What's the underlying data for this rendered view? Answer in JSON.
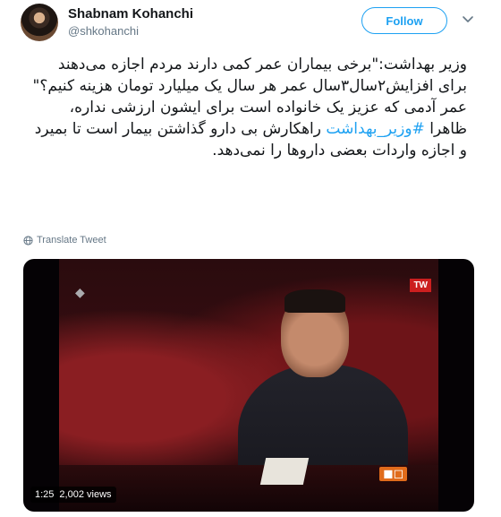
{
  "author": {
    "name": "Shabnam Kohanchi",
    "handle": "@shkohanchi",
    "avatar_icon": "profile-photo"
  },
  "follow_button": {
    "label": "Follow",
    "color": "#1da1f2"
  },
  "menu_icon": "chevron-down-icon",
  "tweet": {
    "line1": "وزیر بهداشت:\"برخی بیماران عمر کمی دارند مردم اجازه می‌دهند برای افزایش۲سال۳سال عمر هر سال یک میلیارد تومان هزینه کنیم؟\"",
    "line2_before": "عمر آدمی که عزیز یک خانواده است برای ایشون ارزشی نداره، ظاهرا ",
    "hashtag": "#وزیر_بهداشت",
    "line2_after": " راهکارش بی دارو گذاشتن بیمار است تا بمیرد و اجازه واردات بعضی داروها را نمی‌دهد.",
    "hashtag_color": "#1da1f2"
  },
  "translate": {
    "label": "Translate Tweet",
    "icon": "globe-icon"
  },
  "video": {
    "duration": "1:25",
    "views": "2,002 views",
    "channel_badge": "TW"
  }
}
